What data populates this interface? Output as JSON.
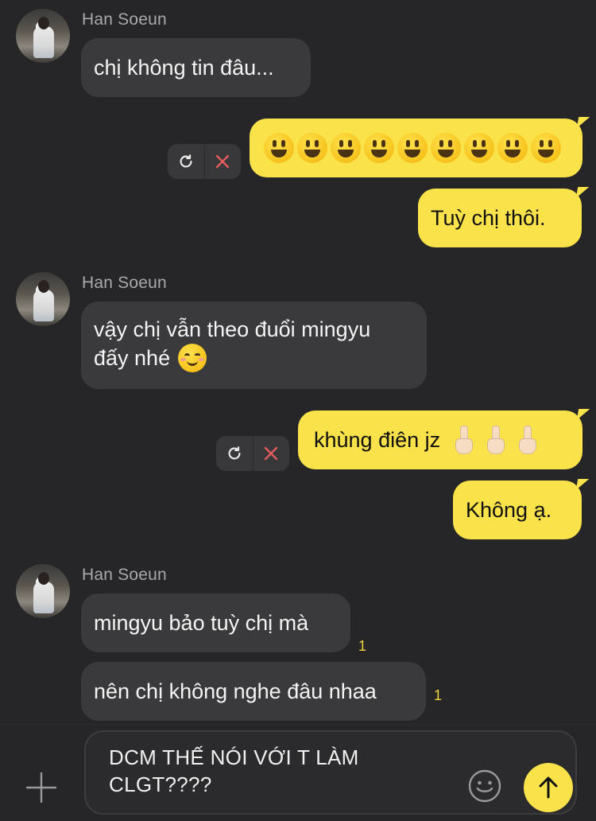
{
  "sender_name": "Han Soeun",
  "groups": [
    {
      "sender": "Han Soeun",
      "messages": [
        "chị không tin đâu..."
      ]
    },
    {
      "sender": "Han Soeun",
      "messages": [
        "vậy chị vẫn theo đuổi mingyu",
        "đấy nhé"
      ]
    },
    {
      "sender": "Han Soeun",
      "messages": [
        "mingyu bảo tuỳ chị mà",
        "nên chị không nghe đâu nhaa"
      ]
    }
  ],
  "outgoing": {
    "smileys_count": 9,
    "tuy_chi_thoi": "Tuỳ chị thôi.",
    "khung_dien": "khùng điên jz",
    "khong_a": "Không ạ."
  },
  "unread_counts": [
    "1",
    "1"
  ],
  "composer": {
    "text": "DCM THẾ NÓI VỚI T LÀM CLGT????"
  },
  "icons": {
    "retry": "retry-icon",
    "cancel": "close-icon",
    "add": "plus-icon",
    "emoji": "emoji-icon",
    "send": "arrow-up-icon"
  },
  "colors": {
    "background": "#262628",
    "incoming_bubble": "#3a3a3d",
    "outgoing_bubble": "#fae34a",
    "unread": "#f3d23f",
    "cancel_red": "#e25b5b"
  }
}
